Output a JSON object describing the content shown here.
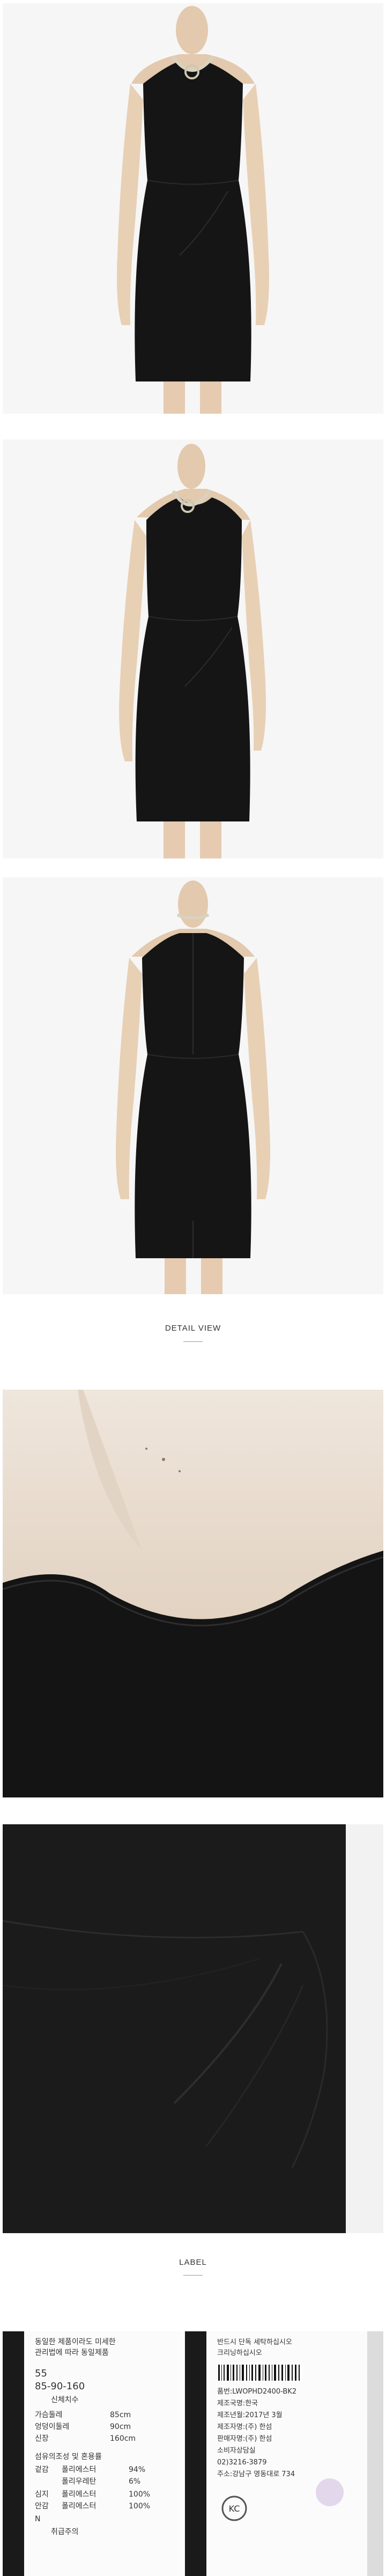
{
  "sections": {
    "detail_view": "DETAIL VIEW",
    "label": "LABEL"
  },
  "care_label_left": {
    "header_line1": "동일한 제품이라도 미세한",
    "header_line2": "관리법에 따라 동일제품",
    "size": "55",
    "size_range": "85-90-160",
    "size_caption": "신체치수",
    "bust_label": "가슴둘레",
    "bust_value": "85cm",
    "hip_label": "엉덩이둘레",
    "hip_value": "90cm",
    "height_label": "신장",
    "height_value": "160cm",
    "fiber_caption": "섬유의조성 및 혼용률",
    "outer_label": "겉감",
    "outer_fiber1": "폴리에스터",
    "outer_pct1": "94%",
    "outer_fiber2": "폴리우레탄",
    "outer_pct2": "6%",
    "trim_label": "심지",
    "trim_fiber": "폴리에스터",
    "trim_pct": "100%",
    "lining_label": "안감",
    "lining_fiber": "폴리에스터",
    "lining_pct": "100%",
    "footer_n": "N",
    "footer_text": "취급주의"
  },
  "care_label_right": {
    "header_line1": "반드시 단독 세탁하십시오",
    "header_line2": "크리닝하십시오",
    "product_no": "품번:LWOPHD2400-BK2",
    "origin": "제조국명:한국",
    "date": "제조년월:2017년 3월",
    "maker": "제조자명:(주) 한섬",
    "seller": "판매자명:(주) 한섬",
    "consumer": "소비자상담실",
    "phone": "02)3216-3879",
    "address": "주소:강남구 영동대로 734",
    "kc_mark": "KC"
  }
}
